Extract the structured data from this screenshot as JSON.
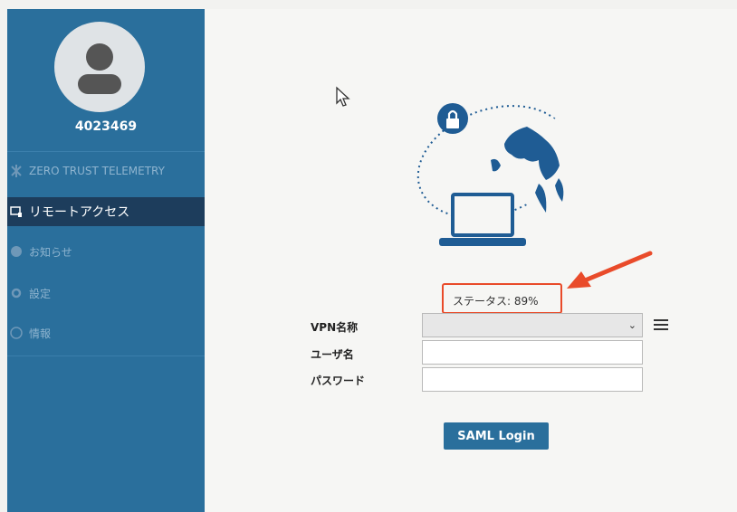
{
  "sidebar": {
    "user_id": "4023469",
    "items": [
      {
        "label": "ZERO TRUST TELEMETRY",
        "icon": "telemetry-icon",
        "active": false
      },
      {
        "label": "リモートアクセス",
        "icon": "remote-access-icon",
        "active": true
      },
      {
        "label": "お知らせ",
        "icon": "info-icon",
        "active": false
      },
      {
        "label": "設定",
        "icon": "gear-icon",
        "active": false
      },
      {
        "label": "情報",
        "icon": "about-icon",
        "active": false
      }
    ]
  },
  "main": {
    "status_text": "ステータス: 89%",
    "form": {
      "vpn_label": "VPN名称",
      "user_label": "ユーザ名",
      "password_label": "パスワード",
      "vpn_value": "",
      "user_value": "",
      "password_value": ""
    },
    "saml_button": "SAML Login"
  },
  "colors": {
    "sidebar": "#2a6f9c",
    "sidebar_active": "#1d3d5c",
    "accent": "#1f5c94",
    "highlight": "#e94b2a"
  }
}
